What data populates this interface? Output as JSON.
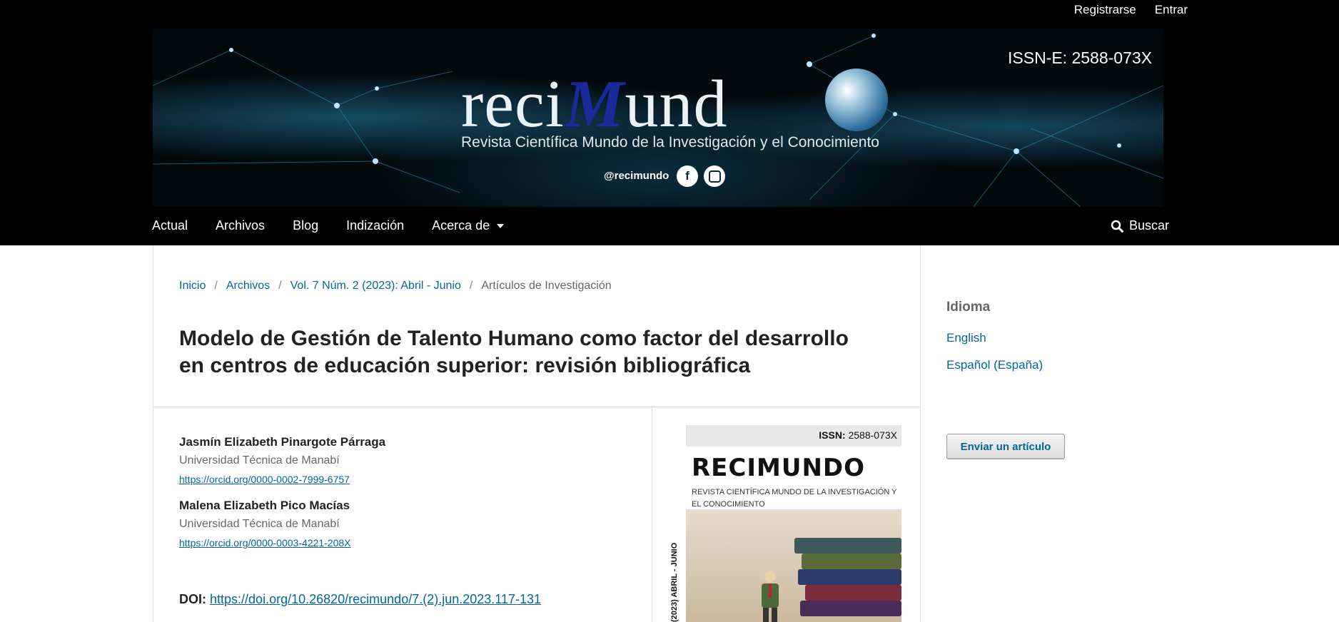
{
  "user_nav": {
    "register": "Registrarse",
    "login": "Entrar"
  },
  "banner": {
    "logo_prefix": "reci",
    "logo_m": "M",
    "logo_suffix": "und",
    "subtitle": "Revista Científica Mundo de la Investigación y el Conocimiento",
    "handle": "@recimundo",
    "issn": "ISSN-E: 2588-073X"
  },
  "main_nav": {
    "items": [
      "Actual",
      "Archivos",
      "Blog",
      "Indización"
    ],
    "about": "Acerca de",
    "search": "Buscar"
  },
  "breadcrumb": {
    "home": "Inicio",
    "archives": "Archivos",
    "issue": "Vol. 7 Núm. 2 (2023): Abril - Junio",
    "section": "Artículos de Investigación",
    "sep": "/"
  },
  "article": {
    "title": "Modelo de Gestión de Talento Humano como factor del desarrollo en centros de educación superior: revisión bibliográfica",
    "authors": [
      {
        "name": "Jasmín Elizabeth Pinargote Párraga",
        "affiliation": "Universidad Técnica de Manabí",
        "orcid": "https://orcid.org/0000-0002-7999-6757"
      },
      {
        "name": "Malena Elizabeth Pico Macías",
        "affiliation": "Universidad Técnica de Manabí",
        "orcid": "https://orcid.org/0000-0003-4221-208X"
      }
    ],
    "doi_label": "DOI:",
    "doi": "https://doi.org/10.26820/recimundo/7.(2).jun.2023.117-131"
  },
  "cover": {
    "issn_label": "ISSN:",
    "issn": "2588-073X",
    "brand": "RECIMUNDO",
    "subtitle": "REVISTA CIENTÍFICA MUNDO DE LA INVESTIGACIÓN Y EL CONOCIMIENTO",
    "side_text": "(2023) ABRIL - JUNIO"
  },
  "sidebar": {
    "language_title": "Idioma",
    "languages": [
      "English",
      "Español (España)"
    ],
    "submit": "Enviar un artículo"
  },
  "colors": {
    "header_bg": "#000000",
    "link": "#006798",
    "text": "#222222"
  }
}
